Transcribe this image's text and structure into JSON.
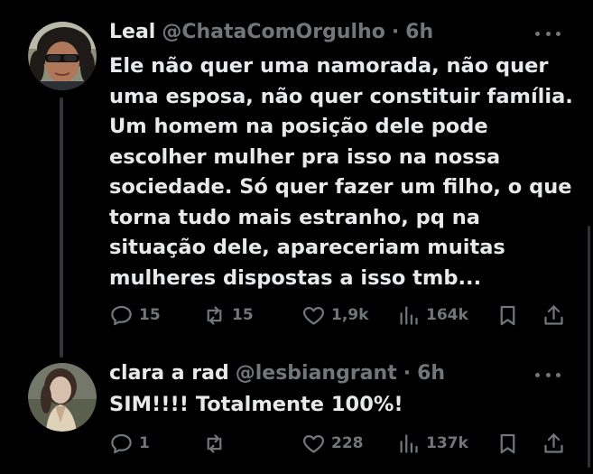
{
  "tweets": [
    {
      "author_name": "Leal",
      "handle": "@ChataComOrgulho",
      "separator": "·",
      "time": "6h",
      "text": "Ele não quer uma namorada, não quer\numa esposa, não quer constituir família.\nUm homem na posição dele pode\nescolher mulher pra isso na nossa\nsociedade. Só quer fazer um filho, o que\ntorna tudo mais estranho, pq na\nsituação dele, apareceriam muitas\nmulheres dispostas a isso tmb...",
      "replies": "15",
      "reposts": "15",
      "likes": "1,9k",
      "views": "164k",
      "avatar_icon": "avatar-woman-sunglasses"
    },
    {
      "author_name": "clara a rad",
      "handle": "@lesbiangrant",
      "separator": "·",
      "time": "6h",
      "text": "SIM!!!! Totalmente 100%!",
      "replies": "1",
      "reposts": "",
      "likes": "228",
      "views": "137k",
      "avatar_icon": "avatar-woman-portrait"
    }
  ],
  "icons": {
    "reply": "reply-icon",
    "repost": "repost-icon",
    "like": "heart-icon",
    "views": "views-icon",
    "bookmark": "bookmark-icon",
    "share": "share-icon",
    "more": "more-icon"
  },
  "colors": {
    "background": "#000000",
    "text_primary": "#e7e9ea",
    "text_secondary": "#71767b",
    "thread_line": "#333639"
  }
}
